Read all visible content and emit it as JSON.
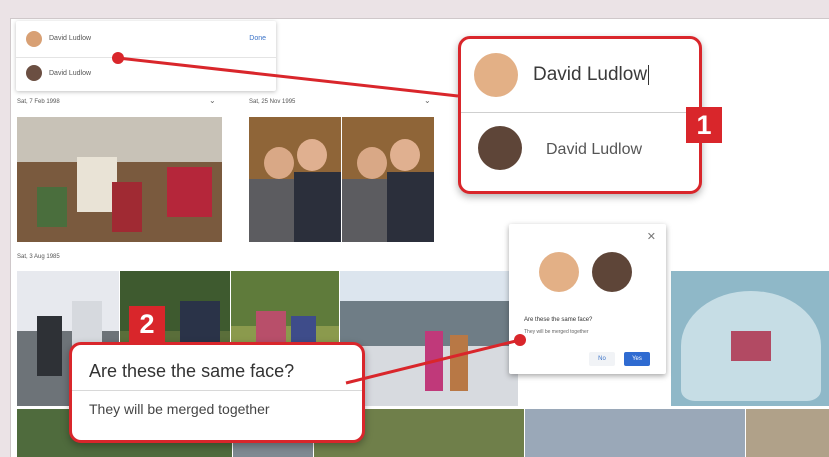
{
  "name_editor": {
    "input_value": "David Ludlow",
    "done_label": "Done",
    "suggestion": "David Ludlow"
  },
  "groups": [
    {
      "date": "Sat, 7 Feb 1998"
    },
    {
      "date": "Sat, 25 Nov 1995"
    },
    {
      "date": "Sat, 3 Aug 1985"
    }
  ],
  "callout1": {
    "input_value": "David Ludlow",
    "suggestion": "David Ludlow",
    "step": "1"
  },
  "merge_dialog": {
    "question": "Are these the same face?",
    "subtext": "They will be merged together",
    "no_label": "No",
    "yes_label": "Yes"
  },
  "callout2": {
    "title": "Are these the same face?",
    "subtitle": "They will be merged together",
    "step": "2"
  },
  "colors": {
    "accent_red": "#d9262b",
    "link_blue": "#3b73c8",
    "button_blue": "#2f6bd1"
  }
}
